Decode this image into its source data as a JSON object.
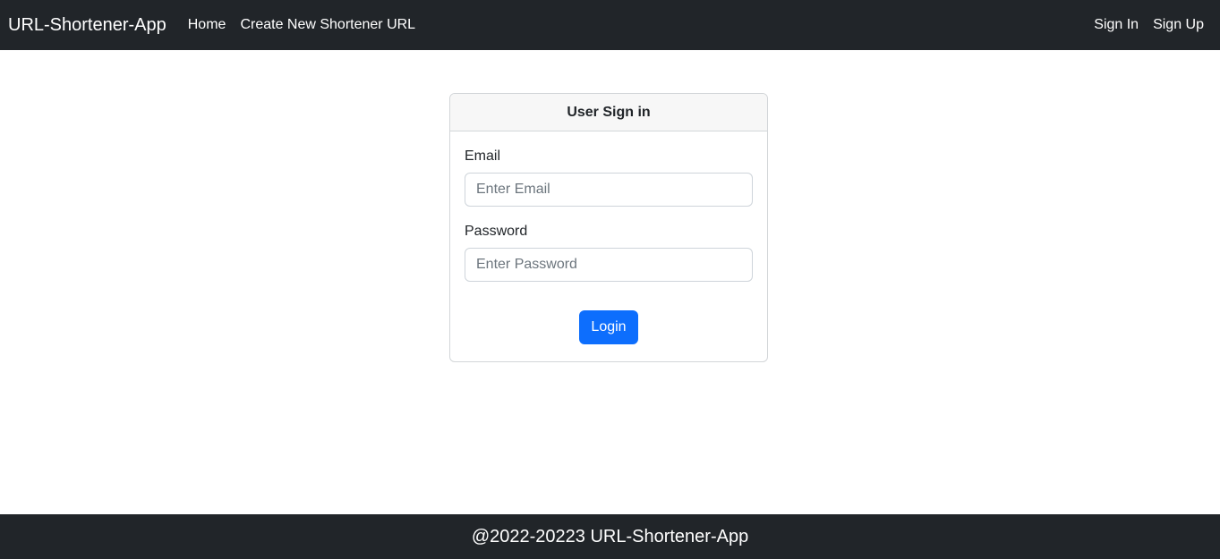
{
  "navbar": {
    "brand": "URL-Shortener-App",
    "left_links": [
      {
        "label": "Home"
      },
      {
        "label": "Create New Shortener URL"
      }
    ],
    "right_links": [
      {
        "label": "Sign In"
      },
      {
        "label": "Sign Up"
      }
    ]
  },
  "signin_card": {
    "title": "User Sign in",
    "email": {
      "label": "Email",
      "placeholder": "Enter Email",
      "value": ""
    },
    "password": {
      "label": "Password",
      "placeholder": "Enter Password",
      "value": ""
    },
    "submit_label": "Login"
  },
  "footer": {
    "text": "@2022-20223 URL-Shortener-App"
  },
  "colors": {
    "navbar_bg": "#212529",
    "primary_button": "#0d6efd",
    "card_header_bg": "#f7f7f7"
  }
}
